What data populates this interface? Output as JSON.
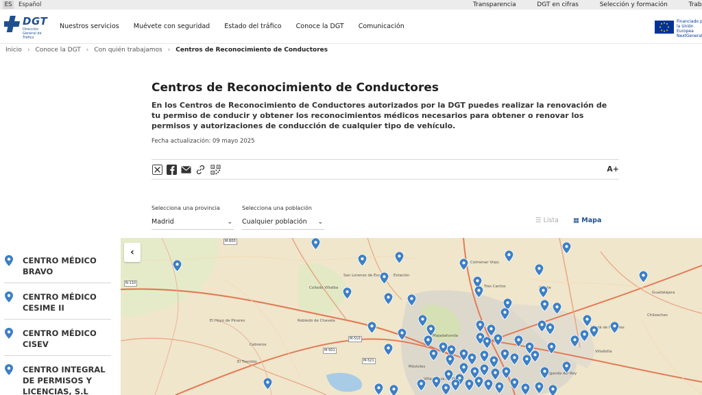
{
  "topbar": {
    "lang_code": "ES",
    "lang_name": "Español",
    "links": [
      "Transparencia",
      "DGT en cifras",
      "Selección y formación",
      "Trabaj"
    ]
  },
  "header": {
    "logo_text": "DGT",
    "logo_sub": "Dirección General de Tráfico",
    "nav": [
      "Nuestros servicios",
      "Muévete con seguridad",
      "Estado del tráfico",
      "Conoce la DGT",
      "Comunicación"
    ],
    "eu_text": "Financiado por la Unión Europea NextGenerationEU"
  },
  "breadcrumb": [
    "Inicio",
    "Conoce la DGT",
    "Con quién trabajamos",
    "Centros de Reconocimiento de Conductores"
  ],
  "main": {
    "title": "Centros de Reconocimiento de Conductores",
    "intro": "En los Centros de Reconocimiento de Conductores autorizados por la DGT puedes realizar la renovación de tu permiso de conducir y obtener los reconocimientos médicos necesarios para obtener o renovar los permisos y autorizaciones de conducción de cualquier tipo de vehículo.",
    "updated": "Fecha actualización: 09 mayo 2025",
    "font_size_btn": "A+"
  },
  "filters": {
    "province_label": "Selecciona una provincia",
    "province_value": "Madrid",
    "town_label": "Selecciona una población",
    "town_value": "Cualquier población",
    "view_list": "Lista",
    "view_map": "Mapa"
  },
  "centers": [
    "CENTRO MÉDICO BRAVO",
    "CENTRO MÉDICO CESIME II",
    "CENTRO MÉDICO CISEV",
    "CENTRO INTEGRAL DE PERMISOS Y LICENCIAS, S.L"
  ],
  "map": {
    "places": [
      "Estación",
      "San Lorenzo de Escorial",
      "Collado Villalba",
      "El Hoyo de Pinares",
      "Robledo de Chavela",
      "El Tiemblo",
      "Cebreros",
      "Colmenar Viejo",
      "Tres Cantos",
      "Algete",
      "Majadahonda",
      "Móstoles",
      "Villaviciosa de Odón",
      "Alcalá de Henares",
      "Chiloeches",
      "Guadalajara",
      "Villalbilla",
      "Arganda del Rey"
    ],
    "roads": [
      "M-510",
      "M-501",
      "M-521",
      "M-600",
      "N-110"
    ],
    "pin_color": "#3d7fc4"
  },
  "colors": {
    "brand": "#1f4f8f",
    "pin": "#3d7fc4"
  }
}
